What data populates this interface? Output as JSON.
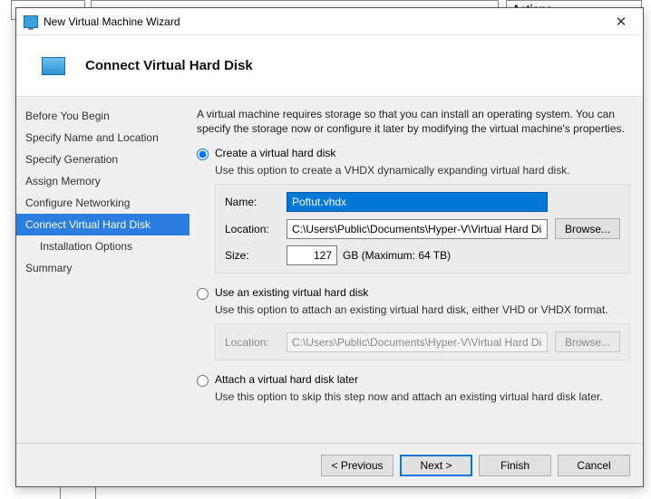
{
  "bg": {
    "actions_tab": "Actions"
  },
  "window": {
    "title": "New Virtual Machine Wizard"
  },
  "header": {
    "title": "Connect Virtual Hard Disk"
  },
  "sidebar": {
    "items": [
      {
        "label": "Before You Begin"
      },
      {
        "label": "Specify Name and Location"
      },
      {
        "label": "Specify Generation"
      },
      {
        "label": "Assign Memory"
      },
      {
        "label": "Configure Networking"
      },
      {
        "label": "Connect Virtual Hard Disk"
      },
      {
        "label": "Installation Options"
      },
      {
        "label": "Summary"
      }
    ]
  },
  "content": {
    "intro": "A virtual machine requires storage so that you can install an operating system. You can specify the storage now or configure it later by modifying the virtual machine's properties.",
    "opt_create": {
      "label": "Create a virtual hard disk",
      "desc": "Use this option to create a VHDX dynamically expanding virtual hard disk.",
      "name_label": "Name:",
      "name_value": "Poftut.vhdx",
      "location_label": "Location:",
      "location_value": "C:\\Users\\Public\\Documents\\Hyper-V\\Virtual Hard Disks\\",
      "browse_label": "Browse...",
      "size_label": "Size:",
      "size_value": "127",
      "size_suffix": "GB (Maximum: 64 TB)"
    },
    "opt_existing": {
      "label": "Use an existing virtual hard disk",
      "desc": "Use this option to attach an existing virtual hard disk, either VHD or VHDX format.",
      "location_label": "Location:",
      "location_value": "C:\\Users\\Public\\Documents\\Hyper-V\\Virtual Hard Disks\\",
      "browse_label": "Browse..."
    },
    "opt_later": {
      "label": "Attach a virtual hard disk later",
      "desc": "Use this option to skip this step now and attach an existing virtual hard disk later."
    }
  },
  "footer": {
    "previous": "< Previous",
    "next": "Next >",
    "finish": "Finish",
    "cancel": "Cancel"
  }
}
